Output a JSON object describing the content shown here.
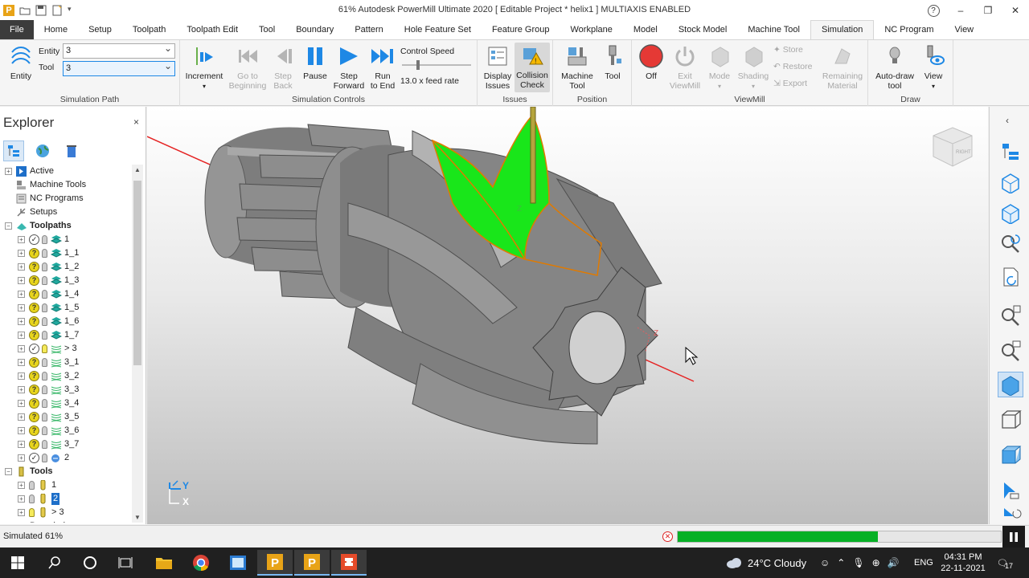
{
  "window": {
    "title": "61% Autodesk PowerMill Ultimate 2020   [ Editable Project * helix1 ]   MULTIAXIS ENABLED",
    "help": "?",
    "minimize": "–",
    "restore": "❐",
    "close": "✕"
  },
  "tabs": [
    "File",
    "Home",
    "Setup",
    "Toolpath",
    "Toolpath Edit",
    "Tool",
    "Boundary",
    "Pattern",
    "Hole Feature Set",
    "Feature Group",
    "Workplane",
    "Model",
    "Stock Model",
    "Machine Tool",
    "Simulation",
    "NC Program",
    "View"
  ],
  "active_tab": "Simulation",
  "ribbon": {
    "simulation_path": {
      "label": "Simulation Path",
      "entity_btn": "Entity",
      "entity_label": "Entity",
      "entity_value": "3",
      "tool_label": "Tool",
      "tool_value": "3"
    },
    "simulation_controls": {
      "label": "Simulation Controls",
      "increment": "Increment",
      "go_to_beginning_1": "Go to",
      "go_to_beginning_2": "Beginning",
      "step_back_1": "Step",
      "step_back_2": "Back",
      "pause": "Pause",
      "step_forward_1": "Step",
      "step_forward_2": "Forward",
      "run_to_end_1": "Run",
      "run_to_end_2": "to End",
      "control_speed": "Control Speed",
      "feed_rate": "13.0 x feed rate"
    },
    "issues": {
      "label": "Issues",
      "display_1": "Display",
      "display_2": "Issues",
      "collision_1": "Collision",
      "collision_2": "Check"
    },
    "position": {
      "label": "Position",
      "machine_1": "Machine",
      "machine_2": "Tool",
      "tool": "Tool"
    },
    "viewmill": {
      "label": "ViewMill",
      "off": "Off",
      "exit_1": "Exit",
      "exit_2": "ViewMill",
      "mode": "Mode",
      "shading": "Shading",
      "store": "Store",
      "restore": "Restore",
      "export": "Export",
      "remaining_1": "Remaining",
      "remaining_2": "Material"
    },
    "draw": {
      "label": "Draw",
      "autodraw_1": "Auto-draw",
      "autodraw_2": "tool",
      "view": "View"
    }
  },
  "explorer": {
    "title": "Explorer",
    "close": "×",
    "items": [
      {
        "label": "Active",
        "indent": 0,
        "exp": "+",
        "icon": "arrow"
      },
      {
        "label": "Machine Tools",
        "indent": 0,
        "exp": "",
        "icon": "machine"
      },
      {
        "label": "NC Programs",
        "indent": 0,
        "exp": "",
        "icon": "nc"
      },
      {
        "label": "Setups",
        "indent": 0,
        "exp": "",
        "icon": "setup"
      },
      {
        "label": "Toolpaths",
        "indent": 0,
        "exp": "−",
        "icon": "toolpaths",
        "bold": true
      },
      {
        "label": "1",
        "indent": 1,
        "exp": "+",
        "status": "check",
        "bulb": "off",
        "icon": "tp"
      },
      {
        "label": "1_1",
        "indent": 1,
        "exp": "+",
        "status": "q",
        "bulb": "off",
        "icon": "tp"
      },
      {
        "label": "1_2",
        "indent": 1,
        "exp": "+",
        "status": "q",
        "bulb": "off",
        "icon": "tp"
      },
      {
        "label": "1_3",
        "indent": 1,
        "exp": "+",
        "status": "q",
        "bulb": "off",
        "icon": "tp"
      },
      {
        "label": "1_4",
        "indent": 1,
        "exp": "+",
        "status": "q",
        "bulb": "off",
        "icon": "tp"
      },
      {
        "label": "1_5",
        "indent": 1,
        "exp": "+",
        "status": "q",
        "bulb": "off",
        "icon": "tp"
      },
      {
        "label": "1_6",
        "indent": 1,
        "exp": "+",
        "status": "q",
        "bulb": "off",
        "icon": "tp"
      },
      {
        "label": "1_7",
        "indent": 1,
        "exp": "+",
        "status": "q",
        "bulb": "off",
        "icon": "tp"
      },
      {
        "label": "> 3",
        "indent": 1,
        "exp": "+",
        "status": "check",
        "bulb": "on",
        "icon": "tp2"
      },
      {
        "label": "3_1",
        "indent": 1,
        "exp": "+",
        "status": "q",
        "bulb": "off",
        "icon": "tp2"
      },
      {
        "label": "3_2",
        "indent": 1,
        "exp": "+",
        "status": "q",
        "bulb": "off",
        "icon": "tp2"
      },
      {
        "label": "3_3",
        "indent": 1,
        "exp": "+",
        "status": "q",
        "bulb": "off",
        "icon": "tp2"
      },
      {
        "label": "3_4",
        "indent": 1,
        "exp": "+",
        "status": "q",
        "bulb": "off",
        "icon": "tp2"
      },
      {
        "label": "3_5",
        "indent": 1,
        "exp": "+",
        "status": "q",
        "bulb": "off",
        "icon": "tp2"
      },
      {
        "label": "3_6",
        "indent": 1,
        "exp": "+",
        "status": "q",
        "bulb": "off",
        "icon": "tp2"
      },
      {
        "label": "3_7",
        "indent": 1,
        "exp": "+",
        "status": "q",
        "bulb": "off",
        "icon": "tp2"
      },
      {
        "label": "2",
        "indent": 1,
        "exp": "+",
        "status": "check",
        "bulb": "off",
        "icon": "tp3"
      },
      {
        "label": "Tools",
        "indent": 0,
        "exp": "−",
        "icon": "tools",
        "bold": true
      },
      {
        "label": "1",
        "indent": 1,
        "exp": "+",
        "bulb": "off",
        "icon": "tool"
      },
      {
        "label": "2",
        "indent": 1,
        "exp": "+",
        "bulb": "off",
        "icon": "tool",
        "selected": true
      },
      {
        "label": "> 3",
        "indent": 1,
        "exp": "+",
        "bulb": "on",
        "icon": "tool"
      },
      {
        "label": "Boundaries",
        "indent": 0,
        "exp": "+",
        "icon": "boundary"
      }
    ]
  },
  "viewport": {
    "axis_y": "Y",
    "axis_x": "X",
    "tool_z1": "Z",
    "tool_z2": "Z",
    "viewcube_label": "RIGHT"
  },
  "status": {
    "text": "Simulated 61%",
    "progress_fraction": 0.62
  },
  "taskbar": {
    "weather": "24°C  Cloudy",
    "lang": "ENG",
    "time": "04:31 PM",
    "date": "22-11-2021",
    "notif": "17"
  },
  "colors": {
    "accent_blue": "#1e88e5",
    "part_grey": "#8a8a8a",
    "cut_green": "#19e61a",
    "progress_green": "#06b025",
    "off_red": "#e53935"
  }
}
